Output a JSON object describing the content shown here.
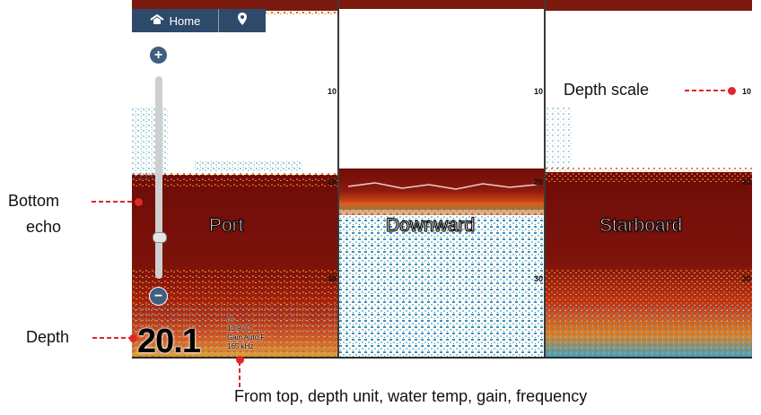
{
  "toolbar": {
    "home_label": "Home",
    "home_icon": "home-icon",
    "pin_icon": "location-pin-icon"
  },
  "zoom": {
    "plus": "+",
    "minus": "−"
  },
  "panels": [
    {
      "label": "Port",
      "ticks": [
        "10",
        "20",
        "30"
      ]
    },
    {
      "label": "Downward",
      "ticks": [
        "10",
        "20",
        "30"
      ]
    },
    {
      "label": "Starboard",
      "ticks": [
        "10",
        "20",
        "30"
      ]
    }
  ],
  "readouts": {
    "depth": "20.1",
    "unit": "m",
    "water_temp": "13.9 °C",
    "gain": "Gain Auto F",
    "frequency": "165 kHz"
  },
  "callouts": {
    "bottom_echo_line1": "Bottom",
    "bottom_echo_line2": "echo",
    "depth": "Depth",
    "depth_scale": "Depth scale",
    "info": "From top, depth unit, water temp, gain, frequency"
  },
  "colors": {
    "toolbar": "#2d4a6b",
    "callout": "#e0262c",
    "echo_strong": "#7a0f0a",
    "echo_medium": "#d84b1a",
    "echo_weak": "#3b8fc0"
  }
}
